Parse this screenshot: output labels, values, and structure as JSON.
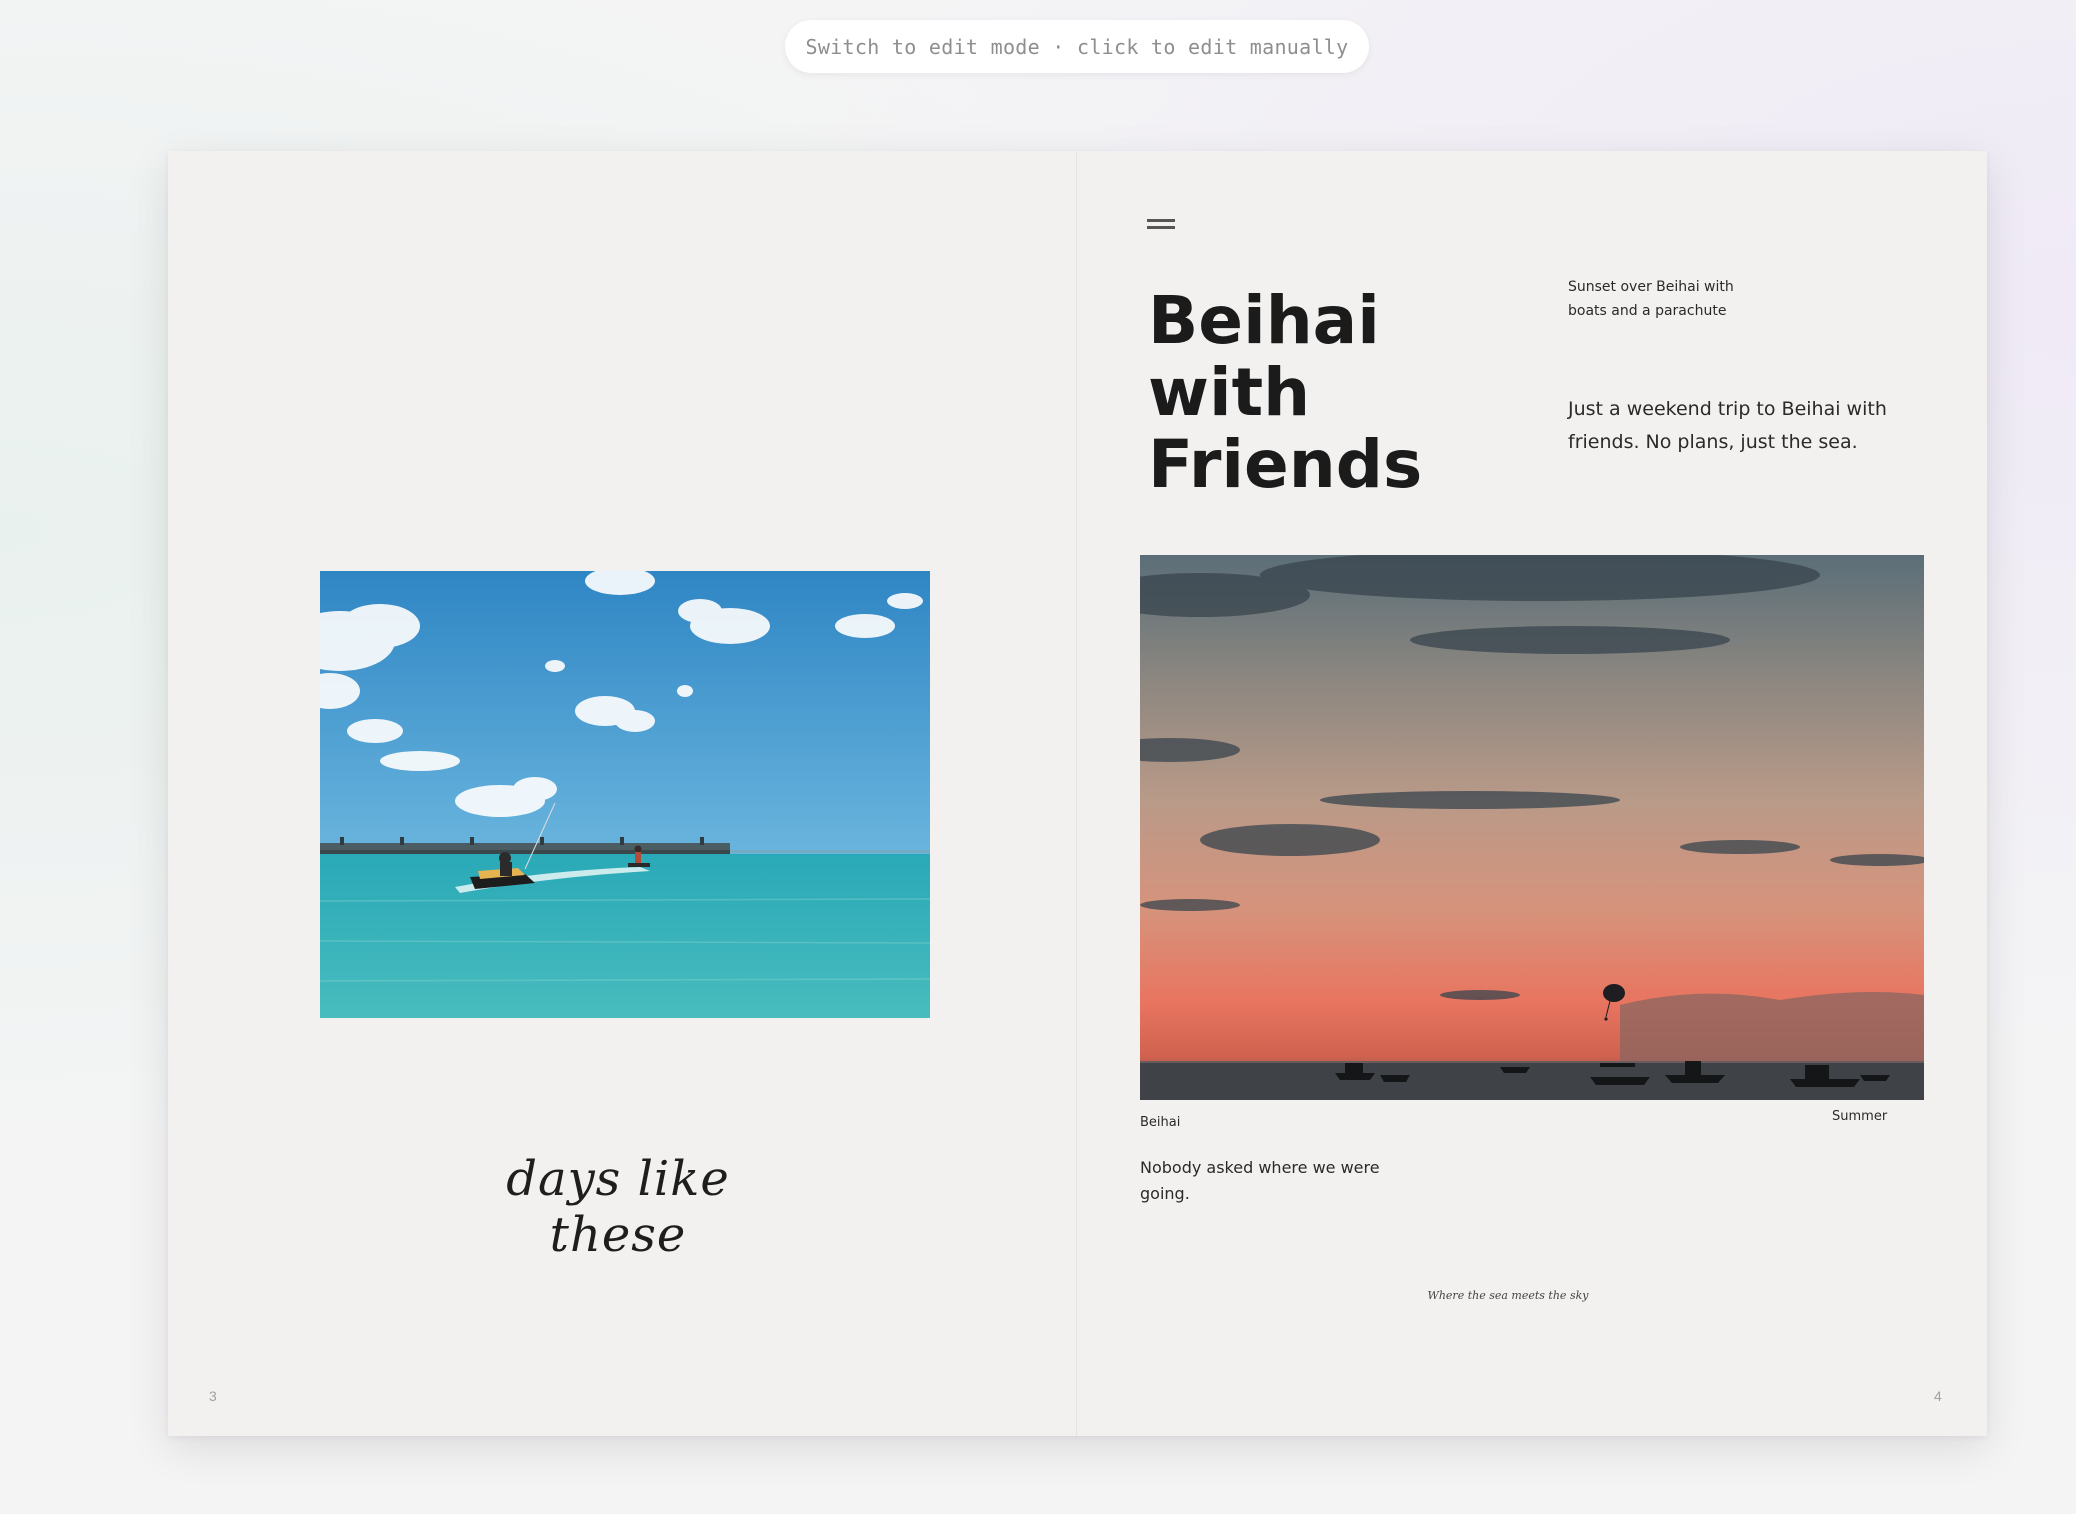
{
  "edit_hint": "Switch to edit mode · click to edit manually",
  "left_page": {
    "caption_script": "days like these",
    "page_number": "3"
  },
  "right_page": {
    "title": "Beihai\nwith\nFriends",
    "photo_caption": "Sunset over Beihai with boats and a parachute",
    "intro": "Just a weekend trip to Beihai with friends. No plans, just the sea.",
    "location_label": "Beihai",
    "season_label": "Summer",
    "body": "Nobody asked where we were going.",
    "tagline": "Where the sea meets the sky",
    "page_number": "4"
  },
  "icons": {
    "menu": "menu-icon"
  },
  "colors": {
    "page_bg": "#f2f1ef",
    "text": "#1b1b1b",
    "sea_turquoise": "#3fb5bd",
    "sky_blue": "#3f93c9",
    "sunset_orange": "#e8735f"
  }
}
